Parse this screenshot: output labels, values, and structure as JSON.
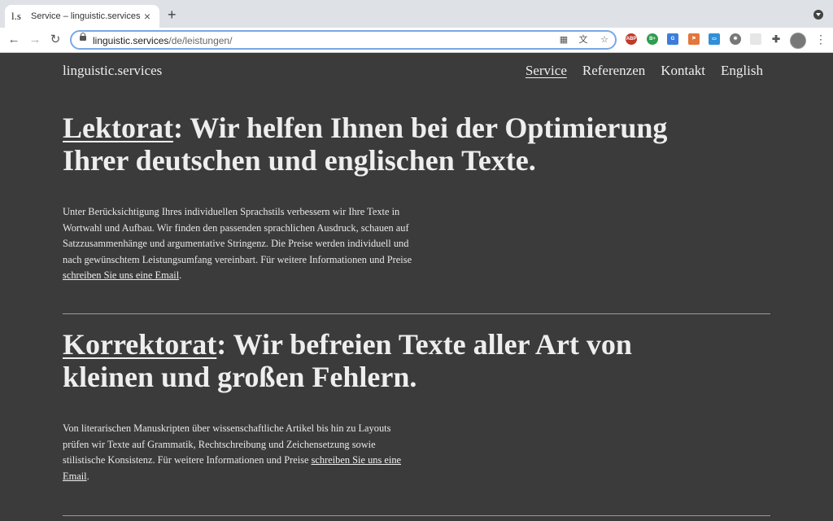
{
  "browser": {
    "tab_favicon": "l.s",
    "tab_title": "Service – linguistic.services",
    "url_domain": "linguistic.services",
    "url_path": "/de/leistungen/"
  },
  "site": {
    "logo": "linguistic.services",
    "nav": [
      {
        "label": "Service",
        "active": true
      },
      {
        "label": "Referenzen"
      },
      {
        "label": "Kontakt"
      },
      {
        "label": "English"
      }
    ]
  },
  "sections": [
    {
      "keyword": "Lektorat",
      "headline_rest": ": Wir helfen Ihnen bei der Optimierung Ihrer deutschen und englischen Texte.",
      "body": "Unter Berücksichtigung Ihres individuellen Sprachstils verbessern wir Ihre Texte in Wortwahl und Aufbau. Wir finden den passenden sprachlichen Ausdruck, schauen auf Satzzusammenhänge und argumentative Stringenz. Die Preise werden individuell und nach gewünschtem Leistungsumfang vereinbart. Für weitere Informationen und Preise ",
      "link": "schreiben Sie uns eine Email",
      "end": "."
    },
    {
      "keyword": "Korrektorat",
      "headline_rest": ": Wir befreien Texte aller Art von kleinen und großen Fehlern.",
      "body": "Von literarischen Manuskripten über wissenschaftliche Artikel bis hin zu Layouts prüfen wir Texte auf Grammatik, Rechtschreibung und Zeichensetzung sowie stilistische Konsistenz. Für weitere Informationen und Preise ",
      "link": "schreiben Sie uns eine Email",
      "end": "."
    }
  ]
}
